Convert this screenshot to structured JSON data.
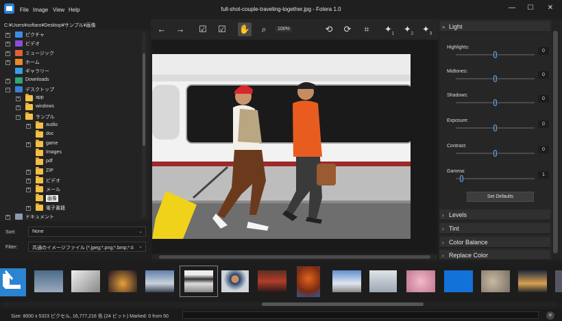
{
  "app": {
    "window_title": "full-shot-couple-traveling-together.jpg - Fotera 1.0",
    "menu": [
      "File",
      "Image",
      "View",
      "Help"
    ],
    "window_controls": {
      "minimize": "—",
      "maximize": "☐",
      "close": "✕"
    }
  },
  "path": "C:¥Users¥softaro¥Desktop¥サンプル¥画像",
  "tree": [
    {
      "label": "ピクチャ",
      "icon": "pictures-icon",
      "expander": "+",
      "level": 0
    },
    {
      "label": "ビデオ",
      "icon": "video-icon",
      "expander": "+",
      "level": 0
    },
    {
      "label": "ミュージック",
      "icon": "music-icon",
      "expander": "+",
      "level": 0
    },
    {
      "label": "ホーム",
      "icon": "home-icon",
      "expander": "+",
      "level": 0
    },
    {
      "label": "ギャラリー",
      "icon": "gallery-icon",
      "expander": "",
      "level": 0
    },
    {
      "label": "Downloads",
      "icon": "download-icon",
      "expander": "+",
      "level": 0
    },
    {
      "label": "デスクトップ",
      "icon": "desktop-icon",
      "expander": "−",
      "level": 0
    },
    {
      "label": "app",
      "icon": "folder-icon",
      "expander": "+",
      "level": 1
    },
    {
      "label": "windows",
      "icon": "folder-icon",
      "expander": "+",
      "level": 1
    },
    {
      "label": "サンプル",
      "icon": "folder-icon",
      "expander": "−",
      "level": 1
    },
    {
      "label": "audio",
      "icon": "folder-icon",
      "expander": "+",
      "level": 2
    },
    {
      "label": "doc",
      "icon": "folder-icon",
      "expander": "",
      "level": 2
    },
    {
      "label": "game",
      "icon": "folder-icon",
      "expander": "+",
      "level": 2
    },
    {
      "label": "Images",
      "icon": "folder-icon",
      "expander": "",
      "level": 2
    },
    {
      "label": "pdf",
      "icon": "folder-icon",
      "expander": "",
      "level": 2
    },
    {
      "label": "ZIP",
      "icon": "folder-icon",
      "expander": "+",
      "level": 2
    },
    {
      "label": "ビデオ",
      "icon": "folder-icon",
      "expander": "+",
      "level": 2
    },
    {
      "label": "メール",
      "icon": "folder-icon",
      "expander": "+",
      "level": 2
    },
    {
      "label": "画像",
      "icon": "folder-icon",
      "expander": "",
      "level": 2,
      "selected": true
    },
    {
      "label": "電子書籍",
      "icon": "folder-icon",
      "expander": "+",
      "level": 2
    },
    {
      "label": "ドキュメント",
      "icon": "documents-icon",
      "expander": "+",
      "level": 0
    }
  ],
  "sort": {
    "label": "Sort:",
    "value": "None"
  },
  "filter": {
    "label": "Filter:",
    "value": "共通のイメージファイル (*.jpeg;*.png;*.bmp;*.ti"
  },
  "toolbar": {
    "back": "←",
    "forward": "→",
    "check": "☑",
    "check_all": "☑",
    "pan": "✋",
    "zoom": "⌕",
    "zoom_level": "100%",
    "rotate_left": "⟲",
    "rotate_right": "⟳",
    "crop": "⌗",
    "wand1": "✦",
    "wand2": "✦",
    "wand3": "✦",
    "wand_sub": [
      "1",
      "2",
      "3"
    ]
  },
  "light": {
    "header": "Light",
    "sliders": [
      {
        "label": "Highlights:",
        "value": "0",
        "level": 0.5
      },
      {
        "label": "Midtones:",
        "value": "0",
        "level": 0.5
      },
      {
        "label": "Shadows:",
        "value": "0",
        "level": 0.5
      },
      {
        "label": "Exposure:",
        "value": "0",
        "level": 0.5
      },
      {
        "label": "Contrast:",
        "value": "0",
        "level": 0.5
      },
      {
        "label": "Gamma:",
        "value": "1",
        "level": 0.05
      }
    ],
    "defaults_button": "Set Defaults"
  },
  "sections": [
    "Levels",
    "Tint",
    "Color Balance",
    "Replace Color"
  ],
  "status": {
    "text": "Size: 8000 x 5323 ピクセル, 16,777,216 色 (24 ビット)    Marked: 0 from 50",
    "close": "✕"
  }
}
